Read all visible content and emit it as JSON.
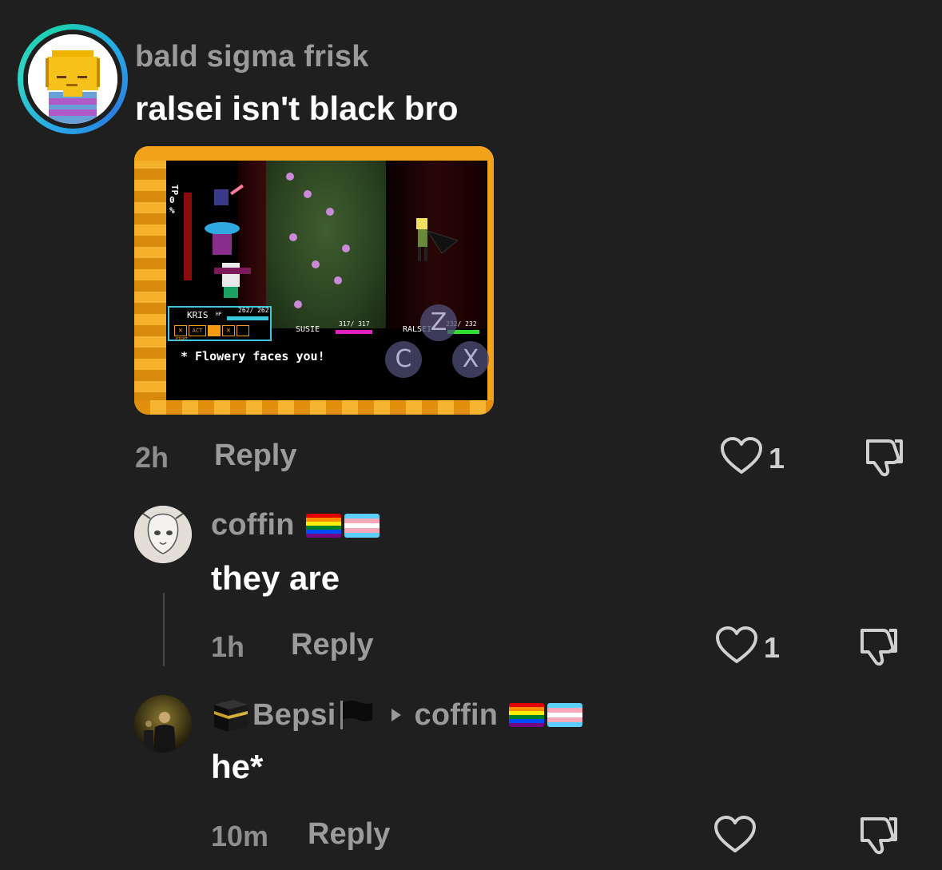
{
  "comment": {
    "username": "bald sigma frisk",
    "text": "ralsei isn't black bro",
    "time": "2h",
    "reply_label": "Reply",
    "like_count": "1",
    "attachment": {
      "game_hud": {
        "tp_label": "TP",
        "tp_value": "0",
        "tp_unit": "%",
        "kris_name": "KRIS",
        "kris_hp": "262/ 262",
        "susie_name": "SUSIE",
        "susie_hp": "317/ 317",
        "ralsei_name": "RALSEI",
        "ralsei_hp": "232/ 232",
        "hp_label": "HP",
        "fight_label": "FIGHT",
        "act_label": "ACT",
        "dialog": "* Flowery faces you!",
        "btn_z": "Z",
        "btn_c": "C",
        "btn_x": "X"
      }
    }
  },
  "replies": [
    {
      "username": "coffin",
      "text": "they are",
      "time": "1h",
      "reply_label": "Reply",
      "like_count": "1"
    },
    {
      "username": "Bepsi",
      "reply_to": "coffin",
      "text": "he*",
      "time": "10m",
      "reply_label": "Reply",
      "like_count": ""
    }
  ],
  "colors": {
    "background": "#1f1f1f",
    "username": "#9a9a9a",
    "text": "#ffffff",
    "ring_start": "#27a9e6",
    "ring_end": "#2fd4c8"
  },
  "icons": [
    "heart-outline-icon",
    "thumbs-down-icon",
    "caret-right-icon",
    "kaaba-emoji",
    "black-flag-emoji",
    "rainbow-flag-emoji",
    "trans-flag-emoji"
  ]
}
